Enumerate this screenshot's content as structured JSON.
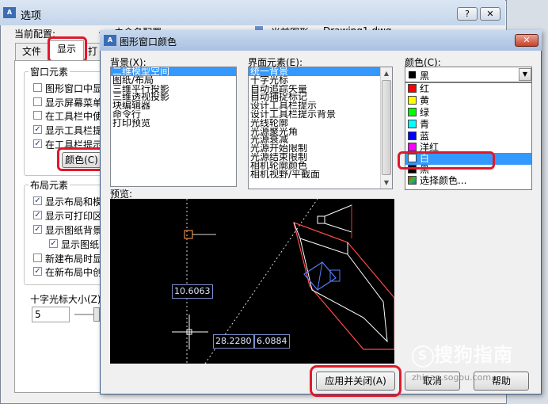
{
  "back_window": {
    "title": "选项",
    "help_button": "?",
    "close_button": "✕",
    "current_profile_label": "当前配置:",
    "current_profile_value": "<<未命名配置>>",
    "current_drawing_label": "当前图形:",
    "current_drawing_value": "Drawing1.dwg",
    "tabs": [
      "文件",
      "显示",
      "打"
    ],
    "window_elements": {
      "title": "窗口元素",
      "items": [
        {
          "label": "图形窗口中显",
          "checked": false
        },
        {
          "label": "显示屏幕菜单",
          "checked": false
        },
        {
          "label": "在工具栏中使",
          "checked": false
        },
        {
          "label": "显示工具栏提",
          "checked": true
        },
        {
          "label": "在工具栏提示",
          "checked": true
        }
      ],
      "color_button": "颜色(C)"
    },
    "layout_elements": {
      "title": "布局元素",
      "items": [
        {
          "label": "显示布局和模",
          "checked": true
        },
        {
          "label": "显示可打印区",
          "checked": true
        },
        {
          "label": "显示图纸背景",
          "checked": true
        },
        {
          "label": "显示图纸",
          "checked": true
        },
        {
          "label": "新建布局时显",
          "checked": false
        },
        {
          "label": "在新布局中创",
          "checked": true
        }
      ]
    },
    "crosshair_label": "十字光标大小(Z)",
    "crosshair_value": "5"
  },
  "dialog": {
    "title": "图形窗口颜色",
    "close_button": "✕",
    "context_label": "背景(X):",
    "contexts": [
      "二维模型空间",
      "图纸/布局",
      "三维平行投影",
      "三维透视投影",
      "块编辑器",
      "命令行",
      "打印预览"
    ],
    "selected_context": 0,
    "element_label": "界面元素(E):",
    "elements": [
      "统一背景",
      "十字光标",
      "自动追踪矢量",
      "自动捕捉标记",
      "设计工具栏提示",
      "设计工具栏提示背景",
      "光线轮廓",
      "光源聚光角",
      "光源衰减",
      "光源开始限制",
      "光源结束限制",
      "相机轮廓颜色",
      "相机视野/平截面"
    ],
    "selected_element": 0,
    "color_label": "颜色(C):",
    "color_value": "黑",
    "color_options": [
      {
        "name": "红",
        "hex": "#ff0000"
      },
      {
        "name": "黄",
        "hex": "#ffff00"
      },
      {
        "name": "绿",
        "hex": "#00ff00"
      },
      {
        "name": "青",
        "hex": "#00ffff"
      },
      {
        "name": "蓝",
        "hex": "#0000ff"
      },
      {
        "name": "洋红",
        "hex": "#ff00ff"
      },
      {
        "name": "白",
        "hex": "#ffffff"
      },
      {
        "name": "黑",
        "hex": "#000000"
      },
      {
        "name": "选择颜色...",
        "hex": "#3a6fd0"
      }
    ],
    "selected_color_option": 6,
    "preview_label": "预览:",
    "preview_numbers": [
      "10.6063",
      "28.2280",
      "6.0884"
    ],
    "apply_close_button": "应用并关闭(A)",
    "cancel_button": "取消",
    "help_button": "帮助"
  },
  "watermark": {
    "brand": "搜狗指南",
    "url": "zhinan.sogou.com"
  },
  "colors": {
    "highlight": "#e0182b",
    "selection": "#3399ff"
  }
}
